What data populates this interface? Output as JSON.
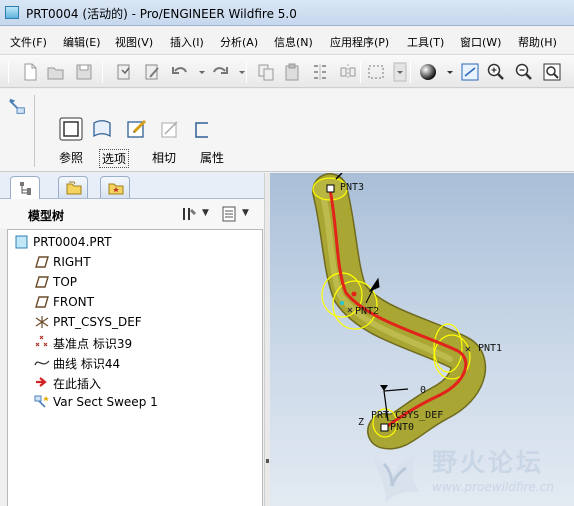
{
  "window": {
    "title": "PRT0004 (活动的) - Pro/ENGINEER Wildfire 5.0"
  },
  "menubar": [
    {
      "label": "文件(F)"
    },
    {
      "label": "编辑(E)"
    },
    {
      "label": "视图(V)"
    },
    {
      "label": "插入(I)"
    },
    {
      "label": "分析(A)"
    },
    {
      "label": "信息(N)"
    },
    {
      "label": "应用程序(P)"
    },
    {
      "label": "工具(T)"
    },
    {
      "label": "窗口(W)"
    },
    {
      "label": "帮助(H)"
    }
  ],
  "toolbar": {
    "icons": [
      "new-icon",
      "open-icon",
      "save-icon",
      "regenerate-icon",
      "edit-icon",
      "undo-icon",
      "redo-icon",
      "copy-icon",
      "paste-icon",
      "paste-special-icon",
      "mirror-icon",
      "select-box-icon",
      "shading-icon",
      "orient-icon",
      "zoom-in-icon",
      "zoom-out-icon",
      "refit-icon"
    ]
  },
  "dashboard": {
    "tools": [
      {
        "label": "参照",
        "icon": "reference-icon"
      },
      {
        "label": "选项",
        "icon": "options-icon"
      },
      {
        "label": "相切",
        "icon": "tangency-icon"
      },
      {
        "label": "属性",
        "icon": "properties-icon"
      }
    ]
  },
  "navigator": {
    "tabs": [
      {
        "icon": "model-tree-tab-icon"
      },
      {
        "icon": "folder-browser-tab-icon"
      },
      {
        "icon": "favorites-tab-icon"
      }
    ],
    "header": "模型树"
  },
  "tree": [
    {
      "label": "PRT0004.PRT",
      "icon": "part-icon"
    },
    {
      "label": "RIGHT",
      "icon": "datum-plane-icon"
    },
    {
      "label": "TOP",
      "icon": "datum-plane-icon"
    },
    {
      "label": "FRONT",
      "icon": "datum-plane-icon"
    },
    {
      "label": "PRT_CSYS_DEF",
      "icon": "csys-icon"
    },
    {
      "label": "基准点 标识39",
      "icon": "datum-point-icon"
    },
    {
      "label": "曲线 标识44",
      "icon": "curve-icon"
    },
    {
      "label": "在此插入",
      "icon": "insert-here-icon"
    },
    {
      "label": "Var Sect Sweep 1",
      "icon": "sweep-icon"
    }
  ],
  "viewport": {
    "labels": {
      "pnt3": "PNT3",
      "pnt2": "PNT2",
      "pnt1": "PNT1",
      "pnt0": "PNT0",
      "csys": "PRT_CSYS_DEF",
      "zero": "0",
      "z": "Z"
    },
    "colors": {
      "sweep": "#8f8f2a",
      "spine": "#e2231a",
      "circles": "#ffff00"
    }
  },
  "watermark": {
    "title": "野火论坛",
    "url": "www.proewildfire.cn"
  }
}
